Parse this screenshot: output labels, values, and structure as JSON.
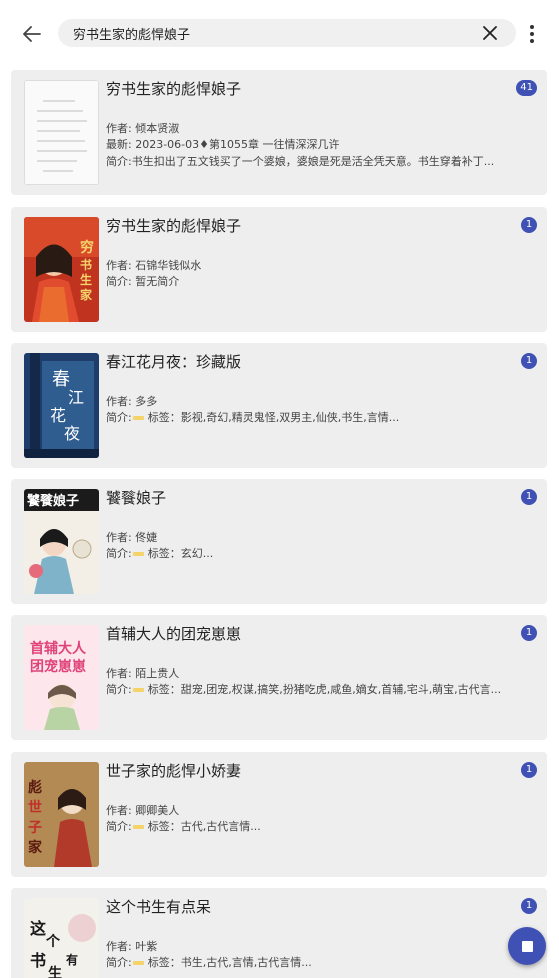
{
  "search": {
    "query": "穷书生家的彪悍娘子"
  },
  "icons": {
    "back": "arrow-left-icon",
    "clear": "close-icon",
    "more": "more-vertical-icon",
    "fab": "stop-icon"
  },
  "colors": {
    "accent": "#3f51b5",
    "card_bg": "#eeeeee",
    "tag_marker": "#f5d36b"
  },
  "results": [
    {
      "title": "穷书生家的彪悍娘子",
      "author": "作者: 倾本贤淑",
      "latest": "最新: 2023-06-03♦第1055章 一往情深深几许",
      "intro": "简介:书生扣出了五文钱买了一个婆娘，婆娘是死是活全凭天意。书生穿着补丁...",
      "badge": "41",
      "cover": "placeholder-document"
    },
    {
      "title": "穷书生家的彪悍娘子",
      "author": "作者: 石锦华钱似水",
      "intro": "简介: 暂无简介",
      "badge": "1",
      "cover": "red-cover"
    },
    {
      "title": "春江花月夜：珍藏版",
      "author": "作者: 多多",
      "intro_prefix": "简介:",
      "tags": "标签：影视,奇幻,精灵鬼怪,双男主,仙侠,书生,言情...",
      "badge": "1",
      "cover": "blue-cover"
    },
    {
      "title": "饕餮娘子",
      "author": "作者: 佟婕",
      "intro_prefix": "简介:",
      "tags": "标签：玄幻...",
      "badge": "1",
      "cover": "ink-cover"
    },
    {
      "title": "首辅大人的团宠崽崽",
      "author": "作者: 陌上贵人",
      "intro_prefix": "简介:",
      "tags": "标签：甜宠,团宠,权谋,搞笑,扮猪吃虎,咸鱼,嫡女,首辅,宅斗,萌宝,古代言...",
      "badge": "1",
      "cover": "pink-cover"
    },
    {
      "title": "世子家的彪悍小娇妻",
      "author": "作者: 卿卿美人",
      "intro_prefix": "简介:",
      "tags": "标签：古代,古代言情...",
      "badge": "1",
      "cover": "gold-cover"
    },
    {
      "title": "这个书生有点呆",
      "author": "作者: 叶紫",
      "intro_prefix": "简介:",
      "tags": "标签：书生,古代,言情,古代言情...",
      "badge": "1",
      "cover": "calligraphy-cover"
    }
  ]
}
